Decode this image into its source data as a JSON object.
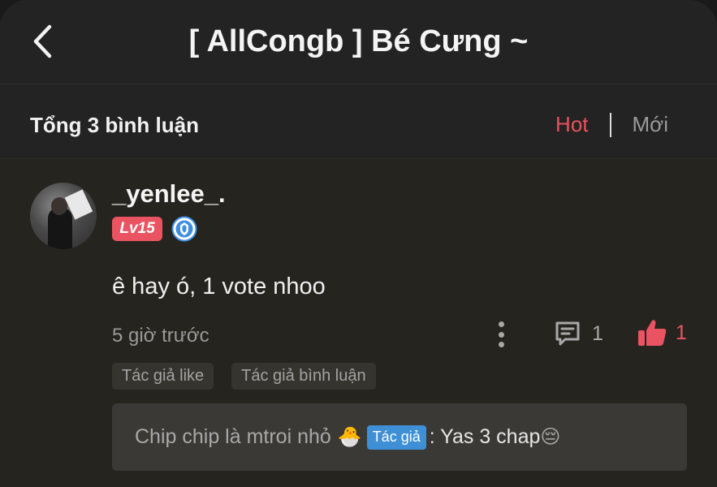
{
  "header": {
    "title": "[ AllCongb ] Bé Cưng ~",
    "back_icon": "chevron-left-icon"
  },
  "comments_bar": {
    "total_label": "Tổng 3 bình luận",
    "sort_tabs": [
      {
        "label": "Hot",
        "active": true,
        "color": "#e8525e"
      },
      {
        "label": "Mới",
        "active": false
      }
    ]
  },
  "comment": {
    "username": "_yenlee_.",
    "level": "Lv15",
    "level_color": "#ea5462",
    "badge_icon": "blue-shield-icon",
    "text": "ê hay ó, 1 vote nhoo",
    "time": "5 giờ trước",
    "reply_count": "1",
    "like_count": "1",
    "like_color": "#ea5462",
    "tags": [
      "Tác giả like",
      "Tác giả bình luận"
    ],
    "reply": {
      "author": "Chip chip là mtroi nhỏ",
      "author_emoji": "🐣",
      "author_badge": "Tác giả",
      "text": ": Yas 3 chap",
      "emoji": "😔"
    }
  }
}
